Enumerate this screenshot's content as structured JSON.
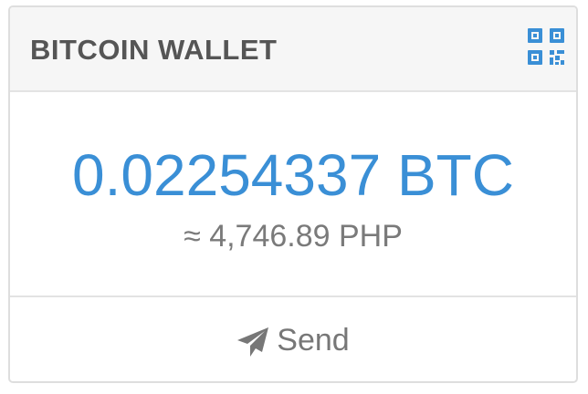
{
  "wallet": {
    "title": "BITCOIN WALLET",
    "balance": "0.02254337 BTC",
    "fiat_equivalent": "≈ 4,746.89 PHP",
    "send_label": "Send"
  },
  "icons": {
    "qr": "qr-code-icon",
    "send": "paper-plane-icon"
  },
  "colors": {
    "accent": "#3a8fd6",
    "title": "#555555",
    "muted": "#7a7a7a"
  }
}
